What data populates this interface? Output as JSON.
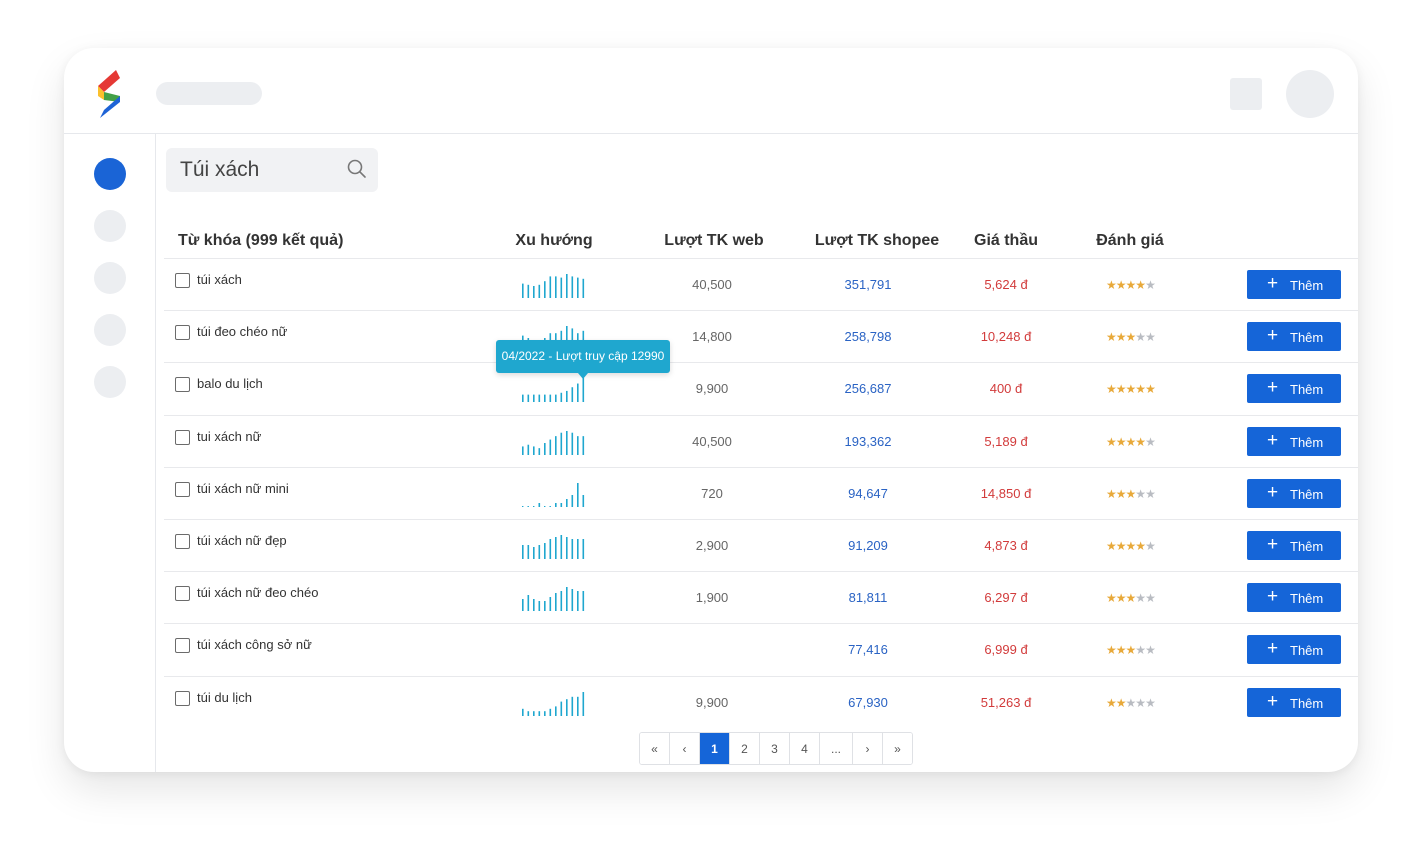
{
  "search": {
    "value": "Túi xách"
  },
  "table": {
    "headers": {
      "keyword": "Từ khóa (999 kết quả)",
      "trend": "Xu hướng",
      "web": "Lượt TK web",
      "shopee": "Lượt TK shopee",
      "bid": "Giá thầu",
      "rating": "Đánh giá"
    },
    "add_label": "Thêm",
    "rows": [
      {
        "keyword": "túi xách",
        "web": "40,500",
        "shopee": "351,791",
        "bid": "5,624 đ",
        "rating": 4,
        "trend": [
          12,
          11,
          10,
          11,
          14,
          18,
          18,
          17,
          20,
          18,
          17,
          16
        ]
      },
      {
        "keyword": "túi đeo chéo nữ",
        "web": "14,800",
        "shopee": "258,798",
        "bid": "10,248 đ",
        "rating": 3,
        "trend": [
          6,
          5,
          4,
          4,
          5,
          7,
          7,
          8,
          10,
          9,
          7,
          8
        ]
      },
      {
        "keyword": "balo du lịch",
        "web": "9,900",
        "shopee": "256,687",
        "bid": "400 đ",
        "rating": 5,
        "trend": [
          4,
          4,
          4,
          4,
          4,
          4,
          4,
          5,
          6,
          8,
          10,
          13
        ]
      },
      {
        "keyword": "tui xách nữ",
        "web": "40,500",
        "shopee": "193,362",
        "bid": "5,189 đ",
        "rating": 4,
        "trend": [
          5,
          6,
          5,
          4,
          7,
          9,
          11,
          13,
          14,
          13,
          11,
          11
        ]
      },
      {
        "keyword": "túi xách nữ mini",
        "web": "720",
        "shopee": "94,647",
        "bid": "14,850 đ",
        "rating": 3,
        "trend": [
          0,
          0,
          0,
          1,
          0,
          0,
          1,
          1,
          2,
          3,
          6,
          3
        ]
      },
      {
        "keyword": "túi xách nữ đẹp",
        "web": "2,900",
        "shopee": "91,209",
        "bid": "4,873 đ",
        "rating": 4,
        "trend": [
          7,
          7,
          6,
          7,
          8,
          10,
          11,
          12,
          11,
          10,
          10,
          10
        ]
      },
      {
        "keyword": "túi xách nữ đeo chéo",
        "web": "1,900",
        "shopee": "81,811",
        "bid": "6,297 đ",
        "rating": 3,
        "trend": [
          6,
          8,
          6,
          5,
          5,
          7,
          9,
          10,
          12,
          11,
          10,
          10
        ]
      },
      {
        "keyword": "túi xách công sở nữ",
        "web": "",
        "shopee": "77,416",
        "bid": "6,999 đ",
        "rating": 3,
        "trend": []
      },
      {
        "keyword": "túi du lịch",
        "web": "9,900",
        "shopee": "67,930",
        "bid": "51,263 đ",
        "rating": 2,
        "trend": [
          3,
          2,
          2,
          2,
          2,
          3,
          4,
          6,
          7,
          8,
          8,
          10
        ]
      }
    ]
  },
  "tooltip": {
    "text": "04/2022 - Lượt truy cập 12990"
  },
  "pagination": [
    "«",
    "‹",
    "1",
    "2",
    "3",
    "4",
    "...",
    "›",
    "»"
  ],
  "pagination_active": "1",
  "colors": {
    "accent": "#1565d8",
    "trend": "#1fa7cf",
    "bid": "#d23b3b",
    "shopee": "#2a63c4",
    "star": "#e8a93a"
  }
}
